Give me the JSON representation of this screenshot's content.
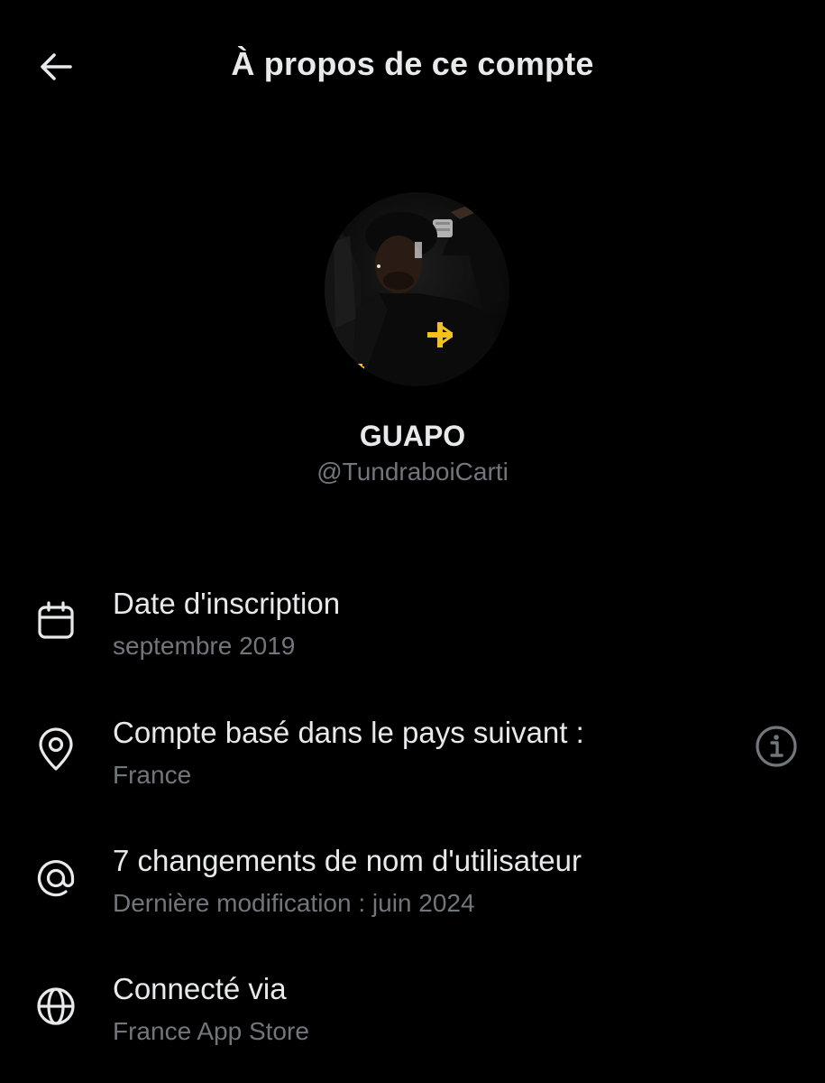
{
  "header": {
    "title": "À propos de ce compte",
    "back_icon": "arrow-left-icon"
  },
  "profile": {
    "name": "GUAPO",
    "handle": "@TundraboiCarti",
    "avatar_icon": "profile-photo"
  },
  "details": {
    "joined": {
      "icon": "calendar-icon",
      "label": "Date d'inscription",
      "value": "septembre 2019"
    },
    "country": {
      "icon": "location-pin-icon",
      "label": "Compte basé dans le pays suivant :",
      "value": "France",
      "info_icon": "info-icon"
    },
    "username_changes": {
      "icon": "at-sign-icon",
      "label": "7 changements de nom d'utilisateur",
      "value": "Dernière modification : juin 2024"
    },
    "connected_via": {
      "icon": "globe-icon",
      "label": "Connecté via",
      "value": "France App Store"
    }
  },
  "colors": {
    "background": "#000000",
    "primary_text": "#e7e9ea",
    "secondary_text": "#71767b",
    "accent_yellow": "#f2c21b"
  }
}
